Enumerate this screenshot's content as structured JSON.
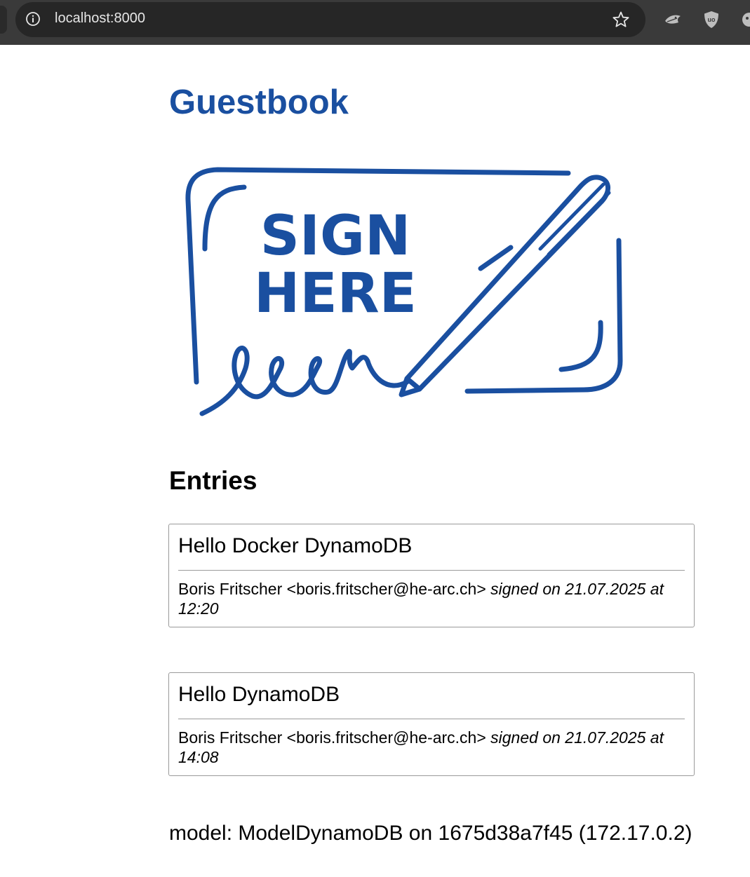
{
  "browser": {
    "url": "localhost:8000",
    "icons": [
      "info-icon",
      "bookmark-star-icon",
      "extension-bird-icon",
      "ublock-origin-icon",
      "extension-icon"
    ]
  },
  "page": {
    "title": "Guestbook",
    "image_alt": "sign here illustration",
    "image_text_line1": "SIGN",
    "image_text_line2": "HERE",
    "entries_heading": "Entries",
    "entries": [
      {
        "message": "Hello Docker DynamoDB",
        "author": "Boris Fritscher <boris.fritscher@he-arc.ch>",
        "signed": "signed on 21.07.2025 at 12:20"
      },
      {
        "message": "Hello DynamoDB",
        "author": "Boris Fritscher <boris.fritscher@he-arc.ch>",
        "signed": "signed on 21.07.2025 at 14:08"
      }
    ],
    "footer": "model: ModelDynamoDB on 1675d38a7f45 (172.17.0.2)"
  },
  "colors": {
    "title_blue": "#1a4fa0",
    "chrome_bg": "#3a3a3a",
    "omnibox_bg": "#262626"
  }
}
